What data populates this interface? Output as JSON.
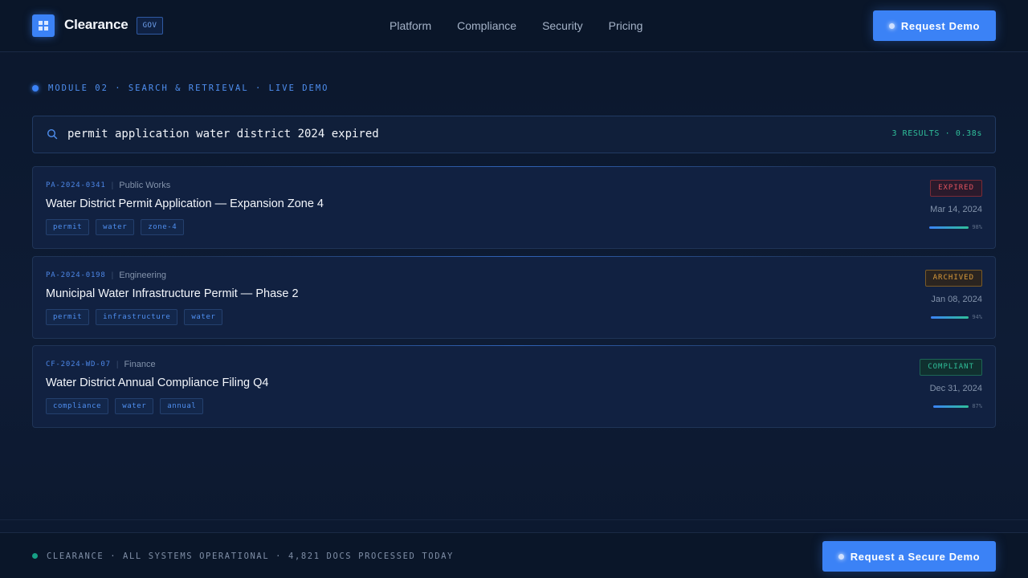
{
  "header": {
    "brand": "Clearance",
    "badge": "GOV",
    "nav": [
      "Platform",
      "Compliance",
      "Security",
      "Pricing"
    ],
    "cta": "Request Demo"
  },
  "module_label": "MODULE 02 · SEARCH & RETRIEVAL · LIVE DEMO",
  "search": {
    "query": "permit application water district 2024 expired",
    "meta": "3 RESULTS · 0.38s"
  },
  "results": [
    {
      "doc_id": "PA-2024-0341",
      "dept": "Public Works",
      "title": "Water District Permit Application — Expansion Zone 4",
      "tags": [
        "permit",
        "water",
        "zone-4"
      ],
      "status": "EXPIRED",
      "date": "Mar 14, 2024",
      "relevance_pct": 98,
      "relevance_label": "98%"
    },
    {
      "doc_id": "PA-2024-0198",
      "dept": "Engineering",
      "title": "Municipal Water Infrastructure Permit — Phase 2",
      "tags": [
        "permit",
        "infrastructure",
        "water"
      ],
      "status": "ARCHIVED",
      "date": "Jan 08, 2024",
      "relevance_pct": 94,
      "relevance_label": "94%"
    },
    {
      "doc_id": "CF-2024-WD-07",
      "dept": "Finance",
      "title": "Water District Annual Compliance Filing Q4",
      "tags": [
        "compliance",
        "water",
        "annual"
      ],
      "status": "COMPLIANT",
      "date": "Dec 31, 2024",
      "relevance_pct": 87,
      "relevance_label": "87%"
    }
  ],
  "footer": {
    "status_text": "CLEARANCE · ALL SYSTEMS OPERATIONAL · 4,821 DOCS PROCESSED TODAY",
    "cta": "Request a Secure Demo"
  },
  "colors": {
    "accent": "#3b82f6",
    "success": "#2fbf9a",
    "expired": "#e0525e",
    "archived": "#d99a3a"
  }
}
